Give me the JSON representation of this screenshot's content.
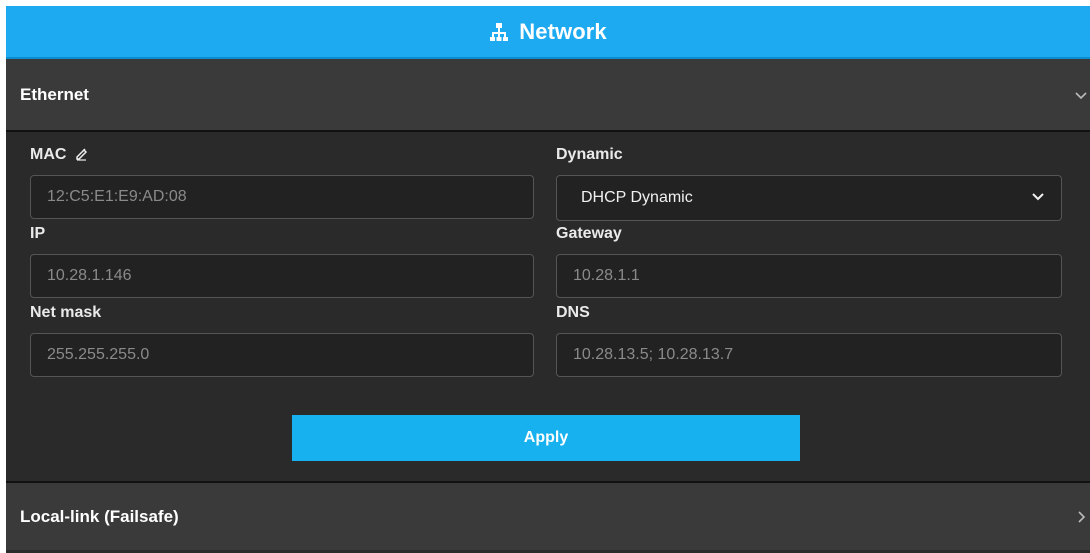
{
  "header": {
    "title": "Network",
    "icon": "network-icon"
  },
  "ethernet": {
    "title": "Ethernet",
    "icon": "chevron-down-icon",
    "mac": {
      "label": "MAC",
      "edit_icon": "pencil-icon",
      "value": "12:C5:E1:E9:AD:08"
    },
    "dynamic": {
      "label": "Dynamic",
      "selected": "DHCP Dynamic",
      "icon": "chevron-down-icon"
    },
    "ip": {
      "label": "IP",
      "value": "10.28.1.146"
    },
    "gateway": {
      "label": "Gateway",
      "value": "10.28.1.1"
    },
    "netmask": {
      "label": "Net mask",
      "value": "255.255.255.0"
    },
    "dns": {
      "label": "DNS",
      "value": "10.28.13.5; 10.28.13.7"
    },
    "apply_label": "Apply"
  },
  "locallink": {
    "title": "Local-link (Failsafe)",
    "icon": "chevron-right-icon"
  },
  "colors": {
    "header": "#1eaaf1",
    "button": "#16b1ee",
    "panel": "#2a2a2a",
    "section": "#3a3a3a"
  }
}
